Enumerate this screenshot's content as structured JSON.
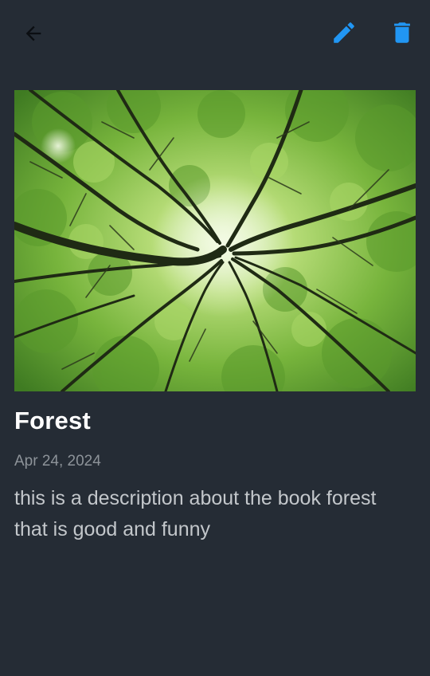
{
  "toolbar": {
    "back_icon": "arrow-back-icon",
    "edit_icon": "pencil-icon",
    "delete_icon": "trash-icon",
    "accent_color": "#2196f3"
  },
  "book": {
    "cover_description_icon": "forest-canopy-photo",
    "title": "Forest",
    "date": "Apr 24, 2024",
    "description": "this is a description about the book forest that is good and funny"
  }
}
